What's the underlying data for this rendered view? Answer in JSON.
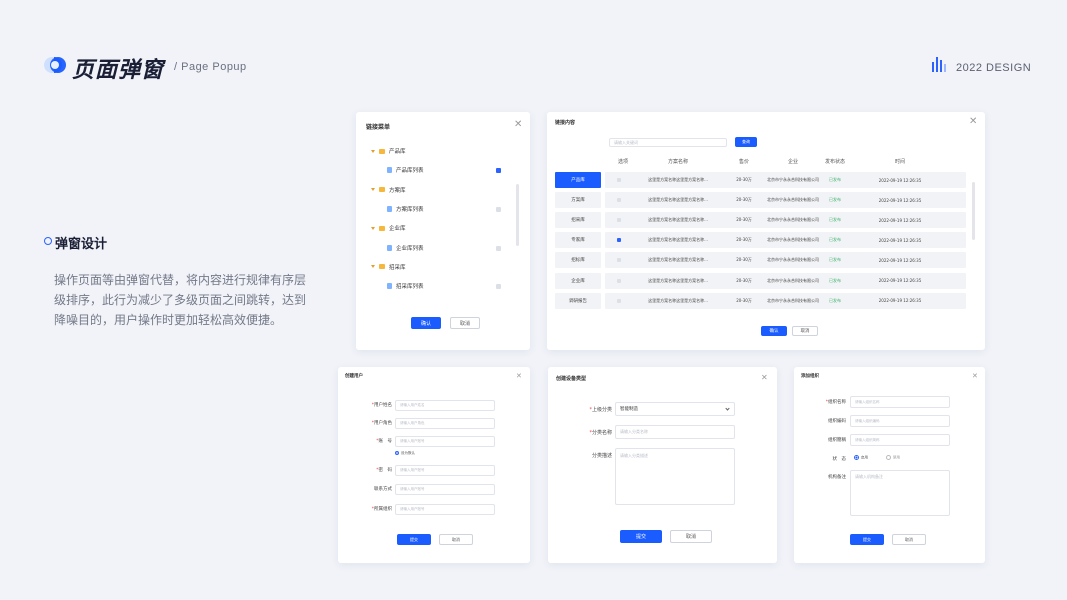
{
  "header": {
    "title": "页面弹窗",
    "subtitle": "/ Page Popup",
    "year_label": "2022 DESIGN",
    "accent": "#2c63ff"
  },
  "section": {
    "title": "弹窗设计",
    "description": "操作页面等由弹窗代替，将内容进行规律有序层级排序，此行为减少了多级页面之间跳转，达到降噪目的，用户操作时更加轻松高效便捷。"
  },
  "tree_dialog": {
    "title": "链接菜单",
    "items": [
      {
        "label": "产品库",
        "type": "folder"
      },
      {
        "label": "产品库列表",
        "type": "file",
        "checked": true
      },
      {
        "label": "方案库",
        "type": "folder"
      },
      {
        "label": "方案库列表",
        "type": "file",
        "checked": false
      },
      {
        "label": "企业库",
        "type": "folder"
      },
      {
        "label": "企业库列表",
        "type": "file",
        "checked": false
      },
      {
        "label": "招采库",
        "type": "folder"
      },
      {
        "label": "招采库列表",
        "type": "file",
        "checked": false
      }
    ],
    "confirm": "确认",
    "cancel": "取消"
  },
  "table_dialog": {
    "title": "链接内容",
    "search_placeholder": "请输入关键词",
    "search_button": "查询",
    "tabs": [
      "产品库",
      "方案库",
      "招采库",
      "专家库",
      "招标库",
      "企业库",
      "调研报告"
    ],
    "active_tab": 0,
    "columns": [
      "选项",
      "方案名称",
      "售价",
      "企业",
      "发布状态",
      "时间"
    ],
    "rows": [
      {
        "checked": false,
        "name": "这里是方案名称这里是方案名称...",
        "price": "20-30万",
        "company": "北京市宁永永合科技有限公司",
        "status": "已发布",
        "time": "2022-09-19 12:26:35"
      },
      {
        "checked": false,
        "name": "这里是方案名称这里是方案名称...",
        "price": "20-30万",
        "company": "北京市宁永永合科技有限公司",
        "status": "已发布",
        "time": "2022-09-19 12:26:35"
      },
      {
        "checked": false,
        "name": "这里是方案名称这里是方案名称...",
        "price": "20-30万",
        "company": "北京市宁永永合科技有限公司",
        "status": "已发布",
        "time": "2022-09-19 12:26:35"
      },
      {
        "checked": true,
        "name": "这里是方案名称这里是方案名称...",
        "price": "20-30万",
        "company": "北京市宁永永合科技有限公司",
        "status": "已发布",
        "time": "2022-09-19 12:26:35"
      },
      {
        "checked": false,
        "name": "这里是方案名称这里是方案名称...",
        "price": "20-30万",
        "company": "北京市宁永永合科技有限公司",
        "status": "已发布",
        "time": "2022-09-19 12:26:35"
      },
      {
        "checked": false,
        "name": "这里是方案名称这里是方案名称...",
        "price": "20-30万",
        "company": "北京市宁永永合科技有限公司",
        "status": "已发布",
        "time": "2022-09-19 12:26:35"
      },
      {
        "checked": false,
        "name": "这里是方案名称这里是方案名称...",
        "price": "20-30万",
        "company": "北京市宁永永合科技有限公司",
        "status": "已发布",
        "time": "2022-09-19 12:26:35"
      }
    ],
    "confirm": "确认",
    "cancel": "取消"
  },
  "user_dialog": {
    "title": "创建用户",
    "fields": [
      {
        "label": "用户姓名",
        "placeholder": "请输入用户姓名",
        "required": true
      },
      {
        "label": "用户角色",
        "placeholder": "请输入用户角色",
        "required": true
      },
      {
        "label": "账　号",
        "placeholder": "请输入用户账号",
        "required": true
      },
      {
        "label": "密　码",
        "placeholder": "请输入用户账号",
        "required": true
      },
      {
        "label": "联系方式",
        "placeholder": "请输入用户账号",
        "required": false
      },
      {
        "label": "所属组织",
        "placeholder": "请输入用户账号",
        "required": true
      }
    ],
    "default_option": "设为默认",
    "submit": "提交",
    "cancel": "取消"
  },
  "device_dialog": {
    "title": "创建设备类型",
    "parent_label": "上级分类",
    "parent_value": "智能制造",
    "name_label": "分类名称",
    "name_placeholder": "请输入分类名称",
    "desc_label": "分类描述",
    "desc_placeholder": "请输入分类描述",
    "submit": "提交",
    "cancel": "取消"
  },
  "org_dialog": {
    "title": "添加组织",
    "fields": [
      {
        "label": "组织名称",
        "placeholder": "请输入组织名称",
        "required": true
      },
      {
        "label": "组织编码",
        "placeholder": "请输入组织编码",
        "required": false
      },
      {
        "label": "组织簡稱",
        "placeholder": "请输入组织简称",
        "required": false
      }
    ],
    "status_label": "状　态",
    "status_on": "启用",
    "status_off": "禁用",
    "remark_label": "机构备注",
    "remark_placeholder": "请输入机构备注",
    "submit": "提交",
    "cancel": "取消"
  }
}
